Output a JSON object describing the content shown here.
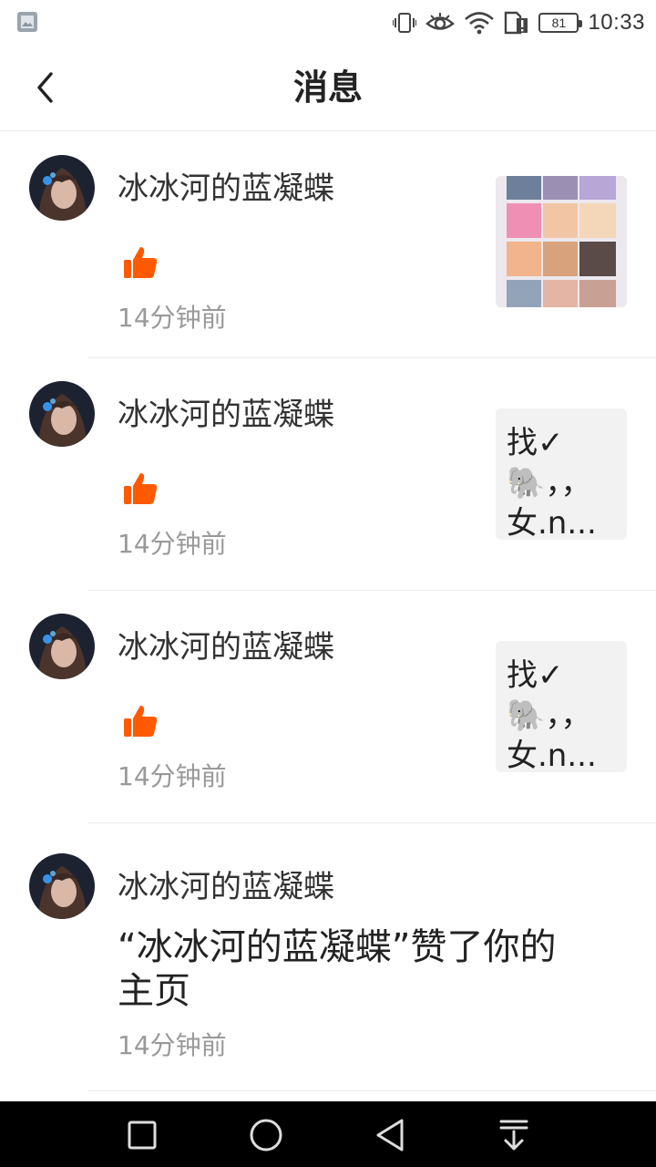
{
  "status_bar": {
    "left_icon": "gallery-icon",
    "icons": [
      "vibrate-icon",
      "eye-icon",
      "wifi-icon",
      "sim-alert-icon"
    ],
    "battery": "81",
    "time": "10:33"
  },
  "header": {
    "back_icon": "chevron-left-icon",
    "title": "消息"
  },
  "messages": [
    {
      "username": "冰冰河的蓝凝蝶",
      "type": "like",
      "time": "14分钟前",
      "thumbnail": "image"
    },
    {
      "username": "冰冰河的蓝凝蝶",
      "type": "like",
      "time": "14分钟前",
      "thumbnail_text": "找✓\n🐘，，\n女.n..."
    },
    {
      "username": "冰冰河的蓝凝蝶",
      "type": "like",
      "time": "14分钟前",
      "thumbnail_text": "找✓\n🐘，，\n女.n..."
    },
    {
      "username": "冰冰河的蓝凝蝶",
      "type": "text",
      "text": "“冰冰河的蓝凝蝶”赞了你的主页",
      "time": "14分钟前"
    }
  ],
  "colors": {
    "like": "#ff5a00",
    "time": "#999999",
    "thumb_bg": "#f2f2f2",
    "nav_bg": "#000000"
  },
  "nav_bar": {
    "icons": [
      "recent-apps-icon",
      "home-icon",
      "back-icon",
      "notification-pull-icon"
    ]
  }
}
